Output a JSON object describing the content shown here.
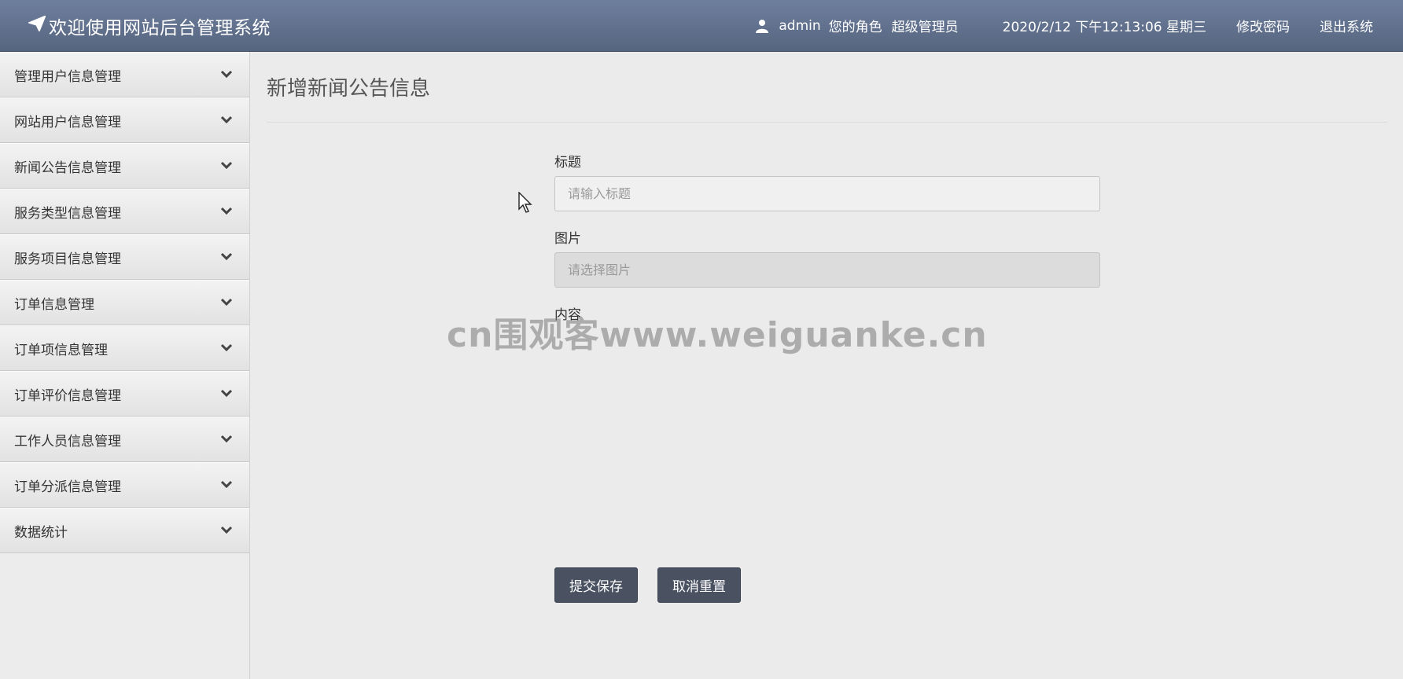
{
  "header": {
    "title": "欢迎使用网站后台管理系统",
    "username": "admin",
    "role_label": "您的角色",
    "role_value": "超级管理员",
    "datetime": "2020/2/12 下午12:13:06 星期三",
    "change_password": "修改密码",
    "logout": "退出系统"
  },
  "sidebar": {
    "items": [
      {
        "label": "管理用户信息管理"
      },
      {
        "label": "网站用户信息管理"
      },
      {
        "label": "新闻公告信息管理"
      },
      {
        "label": "服务类型信息管理"
      },
      {
        "label": "服务项目信息管理"
      },
      {
        "label": "订单信息管理"
      },
      {
        "label": "订单项信息管理"
      },
      {
        "label": "订单评价信息管理"
      },
      {
        "label": "工作人员信息管理"
      },
      {
        "label": "订单分派信息管理"
      },
      {
        "label": "数据统计"
      }
    ]
  },
  "main": {
    "page_title": "新增新闻公告信息",
    "fields": {
      "title_label": "标题",
      "title_placeholder": "请输入标题",
      "image_label": "图片",
      "image_placeholder": "请选择图片",
      "content_label": "内容"
    },
    "buttons": {
      "submit": "提交保存",
      "reset": "取消重置"
    }
  },
  "watermark": "cn围观客www.weiguanke.cn",
  "icons": {
    "brand": "paper-plane-icon",
    "user": "user-icon",
    "chevron": "chevron-down-icon"
  }
}
